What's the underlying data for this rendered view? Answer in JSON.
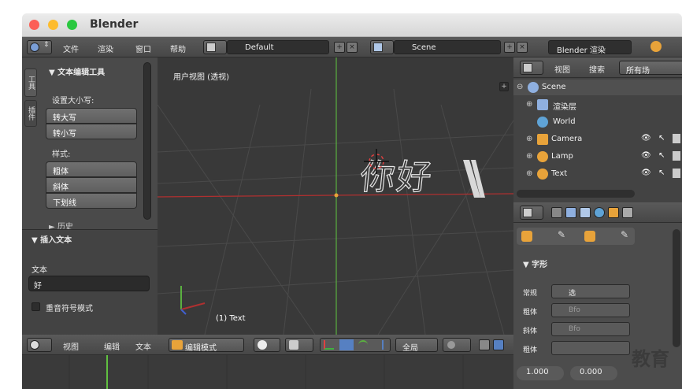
{
  "window": {
    "title": "Blender"
  },
  "topbar": {
    "menus": [
      "文件",
      "渲染",
      "窗口",
      "帮助"
    ],
    "layout": "Default",
    "scene": "Scene",
    "engine": "Blender 渲染"
  },
  "toolshelf": {
    "tabs": [
      "工具",
      "插件"
    ],
    "panel_title": "文本编辑工具",
    "case_label": "设置大小写:",
    "case_buttons": [
      "转大写",
      "转小写"
    ],
    "style_label": "样式:",
    "style_buttons": [
      "粗体",
      "斜体",
      "下划线"
    ],
    "history": "历史",
    "insert_title": "插入文本",
    "text_label": "文本",
    "text_value": "好",
    "accent_label": "重音符号模式"
  },
  "viewport": {
    "label": "用户视图 (透视)",
    "object_text": "你好",
    "status": "(1) Text"
  },
  "bottombar": {
    "menus": [
      "视图",
      "编辑",
      "文本"
    ],
    "mode": "编辑模式",
    "global": "全局"
  },
  "outliner": {
    "menus": [
      "视图",
      "搜索"
    ],
    "filter": "所有场",
    "items": [
      {
        "label": "Scene",
        "icon_color": "#8fb0e0"
      },
      {
        "label": "渲染层",
        "icon_color": "#8fb0e0"
      },
      {
        "label": "World",
        "icon_color": "#5fa3d6"
      },
      {
        "label": "Camera",
        "icon_color": "#e8a33a"
      },
      {
        "label": "Lamp",
        "icon_color": "#e8a33a"
      },
      {
        "label": "Text",
        "icon_color": "#e8a33a"
      }
    ]
  },
  "properties": {
    "section": "字形",
    "rows": [
      {
        "label": "常规",
        "name": "选"
      },
      {
        "label": "粗体",
        "name": "Bfo"
      },
      {
        "label": "斜体",
        "name": "Bfo"
      },
      {
        "label": "粗体",
        "name": ""
      }
    ],
    "values": [
      "1.000",
      "0.000"
    ]
  },
  "watermark": "教育",
  "colors": {
    "x_axis": "#b03030",
    "y_axis": "#5ab040",
    "accent": "#5680c2"
  }
}
